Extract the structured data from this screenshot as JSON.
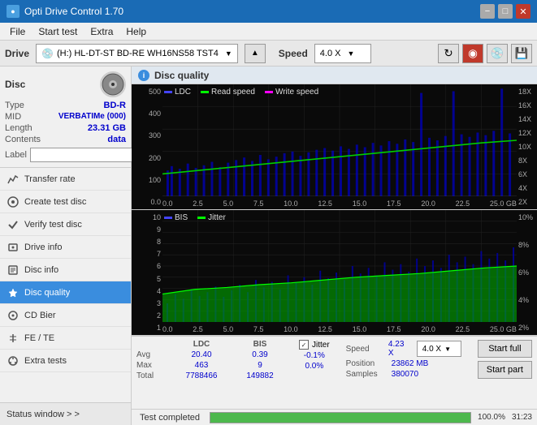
{
  "app": {
    "title": "Opti Drive Control 1.70",
    "icon": "●"
  },
  "titlebar": {
    "minimize": "−",
    "maximize": "□",
    "close": "✕"
  },
  "menu": {
    "items": [
      "File",
      "Start test",
      "Extra",
      "Help"
    ]
  },
  "drive_bar": {
    "label": "Drive",
    "drive_name": "(H:) HL-DT-ST BD-RE  WH16NS58 TST4",
    "speed_label": "Speed",
    "speed_value": "4.0 X"
  },
  "disc_panel": {
    "title": "Disc",
    "type_label": "Type",
    "type_value": "BD-R",
    "mid_label": "MID",
    "mid_value": "VERBATIMe (000)",
    "length_label": "Length",
    "length_value": "23.31 GB",
    "contents_label": "Contents",
    "contents_value": "data",
    "label_label": "Label"
  },
  "nav": {
    "items": [
      {
        "id": "transfer-rate",
        "label": "Transfer rate",
        "icon": "📈"
      },
      {
        "id": "create-test-disc",
        "label": "Create test disc",
        "icon": "💿"
      },
      {
        "id": "verify-test-disc",
        "label": "Verify test disc",
        "icon": "✔"
      },
      {
        "id": "drive-info",
        "label": "Drive info",
        "icon": "ℹ"
      },
      {
        "id": "disc-info",
        "label": "Disc info",
        "icon": "📄"
      },
      {
        "id": "disc-quality",
        "label": "Disc quality",
        "icon": "★"
      },
      {
        "id": "cd-bier",
        "label": "CD Bier",
        "icon": "🔵"
      },
      {
        "id": "fe-te",
        "label": "FE / TE",
        "icon": "↕"
      },
      {
        "id": "extra-tests",
        "label": "Extra tests",
        "icon": "⚙"
      }
    ],
    "active": "disc-quality"
  },
  "status_window": {
    "label": "Status window > >"
  },
  "disc_quality": {
    "title": "Disc quality",
    "chart1": {
      "legend": [
        {
          "label": "LDC",
          "color": "#4444ff"
        },
        {
          "label": "Read speed",
          "color": "#00ff00"
        },
        {
          "label": "Write speed",
          "color": "#ff00ff"
        }
      ],
      "y_labels": [
        "500",
        "400",
        "300",
        "200",
        "100",
        "0.0"
      ],
      "y_right_labels": [
        "18X",
        "16X",
        "14X",
        "12X",
        "10X",
        "8X",
        "6X",
        "4X",
        "2X"
      ],
      "x_labels": [
        "0.0",
        "2.5",
        "5.0",
        "7.5",
        "10.0",
        "12.5",
        "15.0",
        "17.5",
        "20.0",
        "22.5",
        "25.0 GB"
      ]
    },
    "chart2": {
      "legend": [
        {
          "label": "BIS",
          "color": "#4444ff"
        },
        {
          "label": "Jitter",
          "color": "#00ff00"
        }
      ],
      "y_labels": [
        "10",
        "9",
        "8",
        "7",
        "6",
        "5",
        "4",
        "3",
        "2",
        "1"
      ],
      "y_right_labels": [
        "10%",
        "8%",
        "6%",
        "4%",
        "2%"
      ],
      "x_labels": [
        "0.0",
        "2.5",
        "5.0",
        "7.5",
        "10.0",
        "12.5",
        "15.0",
        "17.5",
        "20.0",
        "22.5",
        "25.0 GB"
      ]
    }
  },
  "stats": {
    "headers": [
      "",
      "LDC",
      "BIS",
      "",
      "Jitter",
      "Speed",
      ""
    ],
    "rows": [
      {
        "label": "Avg",
        "ldc": "20.40",
        "bis": "0.39",
        "jitter": "-0.1%",
        "jitter_colored": true
      },
      {
        "label": "Max",
        "ldc": "463",
        "bis": "9",
        "jitter": "0.0%",
        "jitter_colored": true
      },
      {
        "label": "Total",
        "ldc": "7788466",
        "bis": "149882",
        "jitter": ""
      }
    ],
    "jitter_checked": true,
    "jitter_label": "Jitter",
    "speed_label": "Speed",
    "speed_value": "4.23 X",
    "speed_select": "4.0 X",
    "position_label": "Position",
    "position_value": "23862 MB",
    "samples_label": "Samples",
    "samples_value": "380070"
  },
  "buttons": {
    "start_full": "Start full",
    "start_part": "Start part"
  },
  "progress": {
    "value": 100,
    "text": "100.0%",
    "status": "Test completed",
    "time": "31:23"
  }
}
